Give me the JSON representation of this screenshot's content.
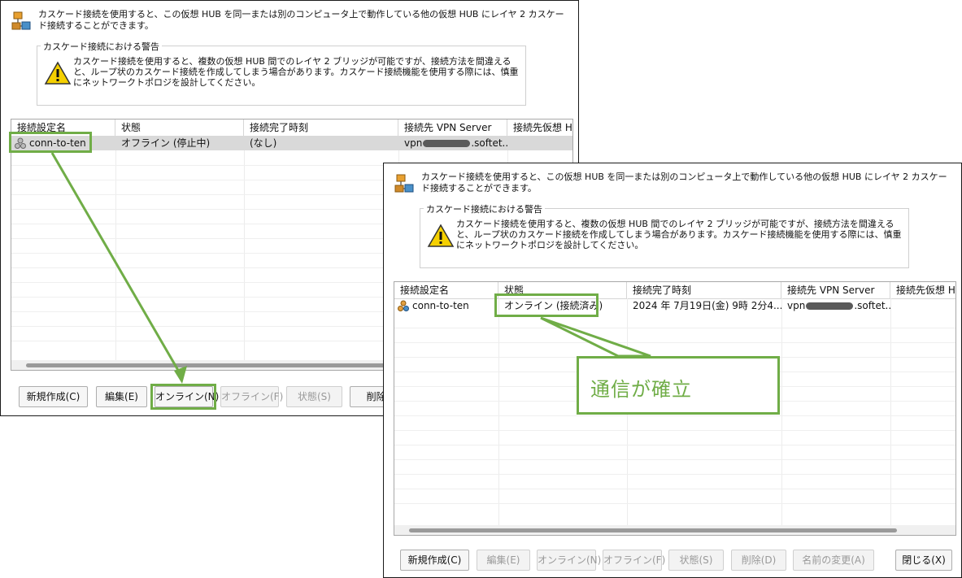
{
  "colors": {
    "highlight": "#70ad47",
    "selected_row": "#d9d9d9"
  },
  "window_before": {
    "intro_text": "カスケード接続を使用すると、この仮想 HUB を同一または別のコンピュータ上で動作している他の仮想 HUB にレイヤ 2 カスケード接続することができます。",
    "warning_title": "カスケード接続における警告",
    "warning_text": "カスケード接続を使用すると、複数の仮想 HUB 間でのレイヤ 2 ブリッジが可能ですが、接続方法を間違えると、ループ状のカスケード接続を作成してしまう場合があります。カスケード接続機能を使用する際には、慎重にネットワークトポロジを設計してください。",
    "columns": [
      "接続設定名",
      "状態",
      "接続完了時刻",
      "接続先 VPN Server",
      "接続先仮想 H"
    ],
    "row": {
      "name": "conn-to-ten",
      "status": "オフライン (停止中)",
      "time": "(なし)",
      "server_prefix": "vpn",
      "server_suffix": ".softet...",
      "hub": ""
    },
    "buttons": {
      "new": "新規作成(C)",
      "edit": "編集(E)",
      "online": "オンライン(N)",
      "offline": "オフライン(F)",
      "status": "状態(S)",
      "delete": "削除("
    }
  },
  "window_after": {
    "intro_text": "カスケード接続を使用すると、この仮想 HUB を同一または別のコンピュータ上で動作している他の仮想 HUB にレイヤ 2 カスケード接続することができます。",
    "warning_title": "カスケード接続における警告",
    "warning_text": "カスケード接続を使用すると、複数の仮想 HUB 間でのレイヤ 2 ブリッジが可能ですが、接続方法を間違えると、ループ状のカスケード接続を作成してしまう場合があります。カスケード接続機能を使用する際には、慎重にネットワークトポロジを設計してください。",
    "columns": [
      "接続設定名",
      "状態",
      "接続完了時刻",
      "接続先 VPN Server",
      "接続先仮想 H"
    ],
    "row": {
      "name": "conn-to-ten",
      "status": "オンライン (接続済み)",
      "time": "2024 年 7月19日(金) 9時 2分4...",
      "server_prefix": "vpn",
      "server_suffix": ".softet...",
      "hub": ""
    },
    "buttons": {
      "new": "新規作成(C)",
      "edit": "編集(E)",
      "online": "オンライン(N)",
      "offline": "オフライン(F)",
      "status": "状態(S)",
      "delete": "削除(D)",
      "rename": "名前の変更(A)",
      "close": "閉じる(X)"
    }
  },
  "callout": {
    "text": "通信が確立"
  }
}
